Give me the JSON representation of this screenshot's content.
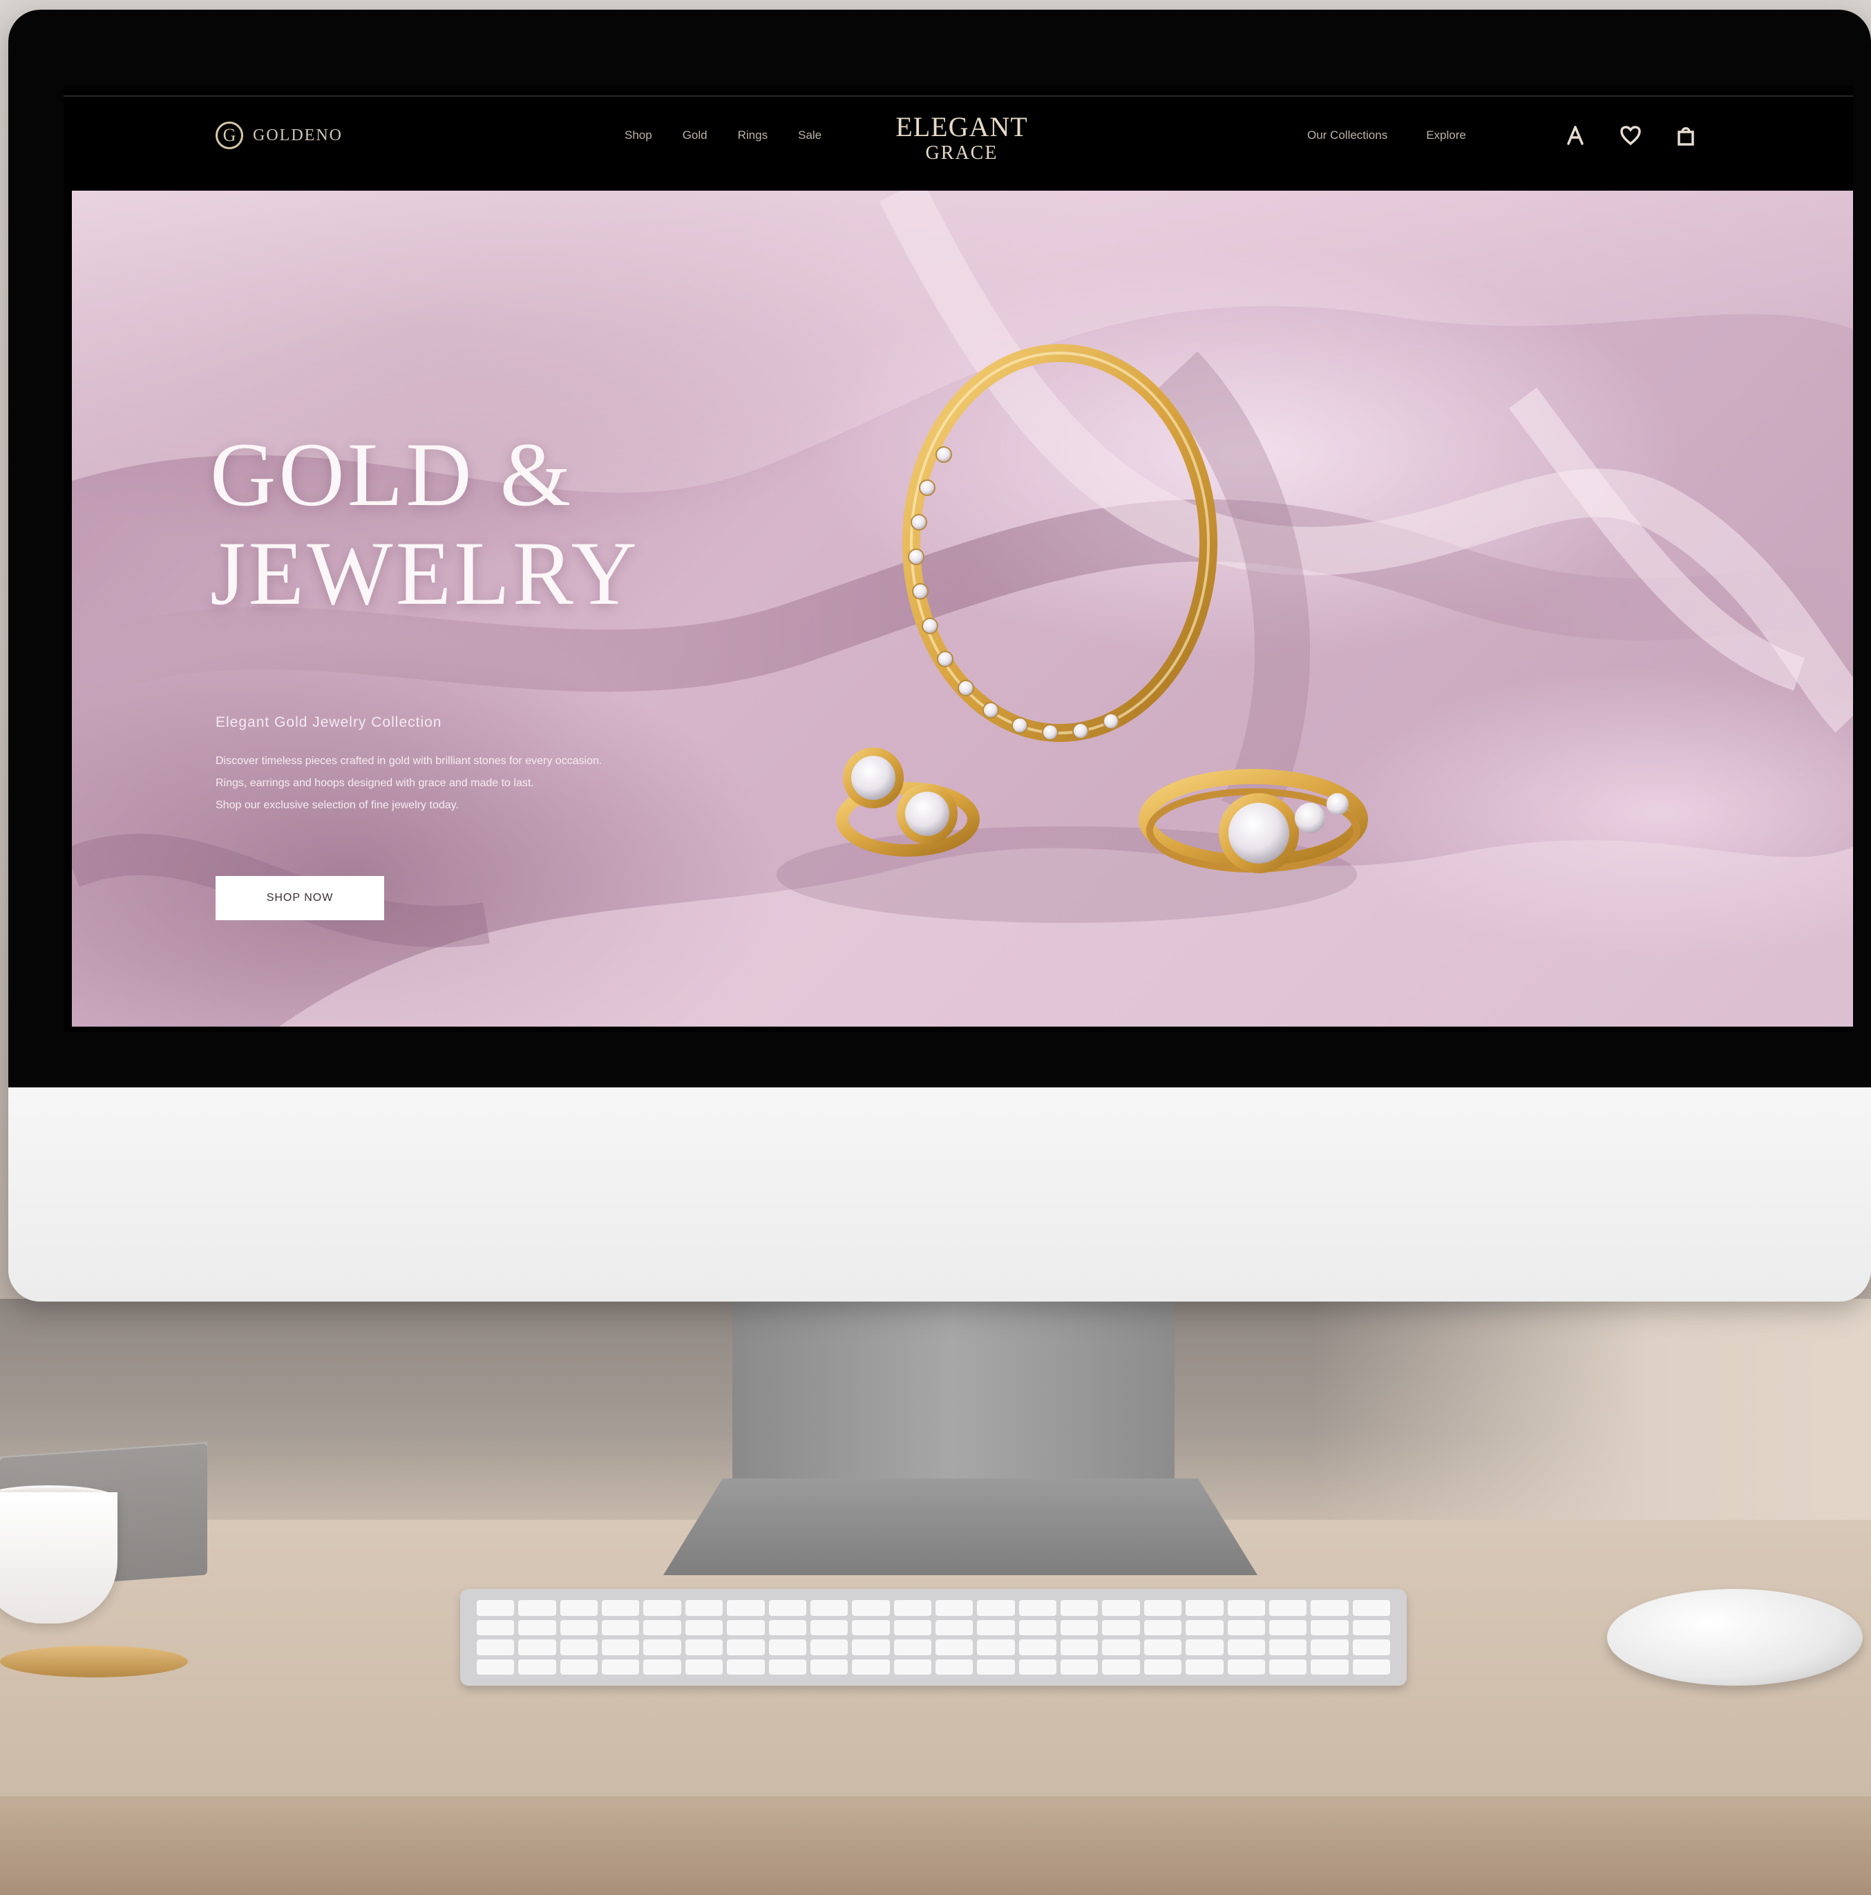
{
  "site": {
    "brand_mark": "G",
    "brand_name": "GOLDENO",
    "logo_line1": "ELEGANT",
    "logo_line2": "GRACE"
  },
  "nav": {
    "links": [
      "Shop",
      "Gold",
      "Rings",
      "Sale"
    ],
    "right_links": [
      "Our Collections",
      "Explore"
    ],
    "icons": [
      "user-icon",
      "heart-icon",
      "bag-icon"
    ]
  },
  "hero": {
    "title_line1": "GOLD &",
    "title_line2": "JEWELRY",
    "subtitle": "Elegant Gold Jewelry Collection",
    "body": [
      "Discover timeless pieces crafted in gold with brilliant stones for every occasion.",
      "Rings, earrings and hoops designed with grace and made to last.",
      "Shop our exclusive selection of fine jewelry today."
    ],
    "cta_label": "SHOP NOW"
  },
  "colors": {
    "nav_bg": "#000000",
    "hero_silk": "#c9a7bd",
    "gold": "#d9a440",
    "text_light": "#fbf6f8"
  }
}
